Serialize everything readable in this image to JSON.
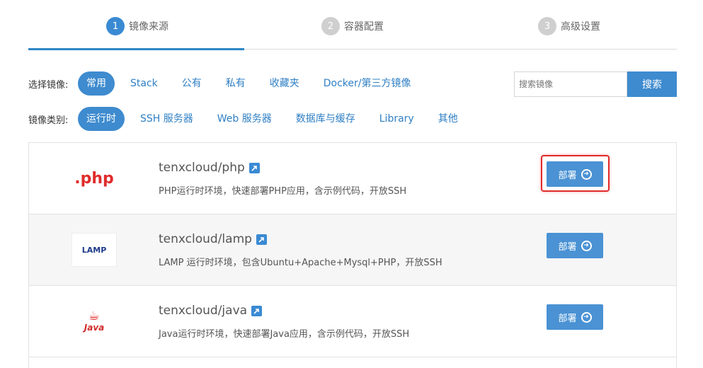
{
  "steps": [
    {
      "num": "1",
      "label": "镜像来源"
    },
    {
      "num": "2",
      "label": "容器配置"
    },
    {
      "num": "3",
      "label": "高级设置"
    }
  ],
  "filters": {
    "select_label": "选择镜像:",
    "select_options": [
      "常用",
      "Stack",
      "公有",
      "私有",
      "收藏夹",
      "Docker/第三方镜像"
    ],
    "category_label": "镜像类别:",
    "category_options": [
      "运行时",
      "SSH 服务器",
      "Web 服务器",
      "数据库与缓存",
      "Library",
      "其他"
    ]
  },
  "search": {
    "placeholder": "搜索镜像",
    "button": "搜索"
  },
  "images": [
    {
      "logo_text": ".php",
      "name": "tenxcloud/php",
      "desc": "PHP运行时环境，快速部署PHP应用，含示例代码，开放SSH",
      "deploy": "部署"
    },
    {
      "logo_text": "LAMP",
      "name": "tenxcloud/lamp",
      "desc": "LAMP 运行时环境，包含Ubuntu+Apache+Mysql+PHP，开放SSH",
      "deploy": "部署"
    },
    {
      "logo_text": "Java",
      "name": "tenxcloud/java",
      "desc": "Java运行时环境，快速部署Java应用，含示例代码，开放SSH",
      "deploy": "部署"
    }
  ],
  "colors": {
    "accent": "#3e8bcf",
    "highlight": "#e02b2b"
  }
}
